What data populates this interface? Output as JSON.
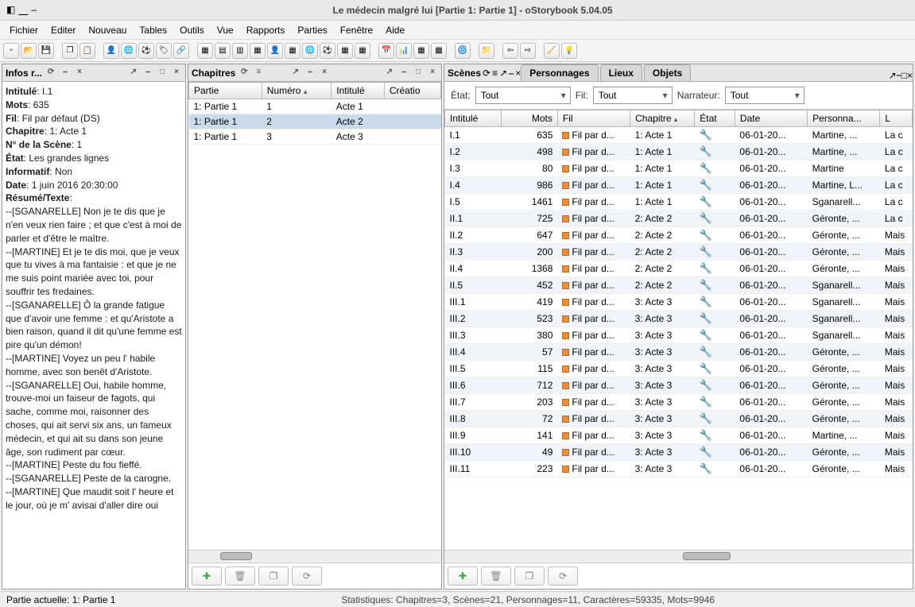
{
  "window": {
    "title": "Le médecin malgré lui [Partie 1: Partie 1] - oStorybook 5.04.05"
  },
  "menu": [
    "Fichier",
    "Editer",
    "Nouveau",
    "Tables",
    "Outils",
    "Vue",
    "Rapports",
    "Parties",
    "Fenêtre",
    "Aide"
  ],
  "panels": {
    "info": {
      "title": "Infos r..."
    },
    "chapters": {
      "title": "Chapitres"
    },
    "scenes": {
      "title": "Scènes"
    }
  },
  "tabs": {
    "personnages": "Personnages",
    "lieux": "Lieux",
    "objets": "Objets"
  },
  "info": {
    "intitule_lbl": "Intitulé",
    "intitule": "I.1",
    "mots_lbl": "Mots",
    "mots": "635",
    "fil_lbl": "Fil",
    "fil": "Fil par défaut (DS)",
    "chapitre_lbl": "Chapitre",
    "chapitre": "1: Acte 1",
    "numscene_lbl": "N° de la Scène",
    "numscene": "1",
    "etat_lbl": "État",
    "etat": "Les grandes lignes",
    "informatif_lbl": "Informatif",
    "informatif": "Non",
    "date_lbl": "Date",
    "date": "1 juin 2016 20:30:00",
    "resume_lbl": "Résumé/Texte",
    "body": "--[SGANARELLE] Non je te dis que je n'en veux rien faire ; et que c'est à moi de parler et d'être le maître.\n--[MARTINE] Et je te dis moi, que je veux que tu vives à ma fantaisie : et que je ne me suis point mariée avec toi, pour souffrir tes fredaines.\n--[SGANARELLE] Ô la grande fatigue que d'avoir une femme : et qu'Aristote a bien raison, quand il dit qu'une femme est pire qu'un démon!\n--[MARTINE] Voyez un peu l' habile homme, avec son benêt d'Aristote.\n--[SGANARELLE] Oui, habile homme, trouve-moi un faiseur de fagots, qui sache, comme moi, raisonner des choses, qui ait servi six ans, un fameux médecin, et qui ait su dans son jeune âge, son rudiment par cœur.\n--[MARTINE] Peste du fou fieffé.\n--[SGANARELLE] Peste de la carogne.\n--[MARTINE] Que maudit soit l' heure et le jour, où je m' avisai d'aller dire oui"
  },
  "chapters": {
    "headers": {
      "partie": "Partie",
      "numero": "Numéro",
      "intitule": "Intitulé",
      "creation": "Créatio"
    },
    "rows": [
      {
        "partie": "1: Partie 1",
        "num": "1",
        "intitule": "Acte 1"
      },
      {
        "partie": "1: Partie 1",
        "num": "2",
        "intitule": "Acte 2"
      },
      {
        "partie": "1: Partie 1",
        "num": "3",
        "intitule": "Acte 3"
      }
    ]
  },
  "filters": {
    "etat_lbl": "État:",
    "etat_val": "Tout",
    "fil_lbl": "Fil:",
    "fil_val": "Tout",
    "narr_lbl": "Narrateur:",
    "narr_val": "Tout"
  },
  "scenes": {
    "headers": {
      "intitule": "Intitulé",
      "mots": "Mots",
      "fil": "Fil",
      "chapitre": "Chapitre",
      "etat": "État",
      "date": "Date",
      "persos": "Personna...",
      "l": "L"
    },
    "rows": [
      {
        "i": "I.1",
        "m": "635",
        "f": "Fil par d...",
        "c": "1: Acte 1",
        "d": "06-01-20...",
        "p": "Martine, ...",
        "l": "La c"
      },
      {
        "i": "I.2",
        "m": "498",
        "f": "Fil par d...",
        "c": "1: Acte 1",
        "d": "06-01-20...",
        "p": "Martine, ...",
        "l": "La c"
      },
      {
        "i": "I.3",
        "m": "80",
        "f": "Fil par d...",
        "c": "1: Acte 1",
        "d": "06-01-20...",
        "p": "Martine",
        "l": "La c"
      },
      {
        "i": "I.4",
        "m": "986",
        "f": "Fil par d...",
        "c": "1: Acte 1",
        "d": "06-01-20...",
        "p": "Martine, L...",
        "l": "La c"
      },
      {
        "i": "I.5",
        "m": "1461",
        "f": "Fil par d...",
        "c": "1: Acte 1",
        "d": "06-01-20...",
        "p": "Sganarell...",
        "l": "La c"
      },
      {
        "i": "II.1",
        "m": "725",
        "f": "Fil par d...",
        "c": "2: Acte 2",
        "d": "06-01-20...",
        "p": "Géronte, ...",
        "l": "La c"
      },
      {
        "i": "II.2",
        "m": "647",
        "f": "Fil par d...",
        "c": "2: Acte 2",
        "d": "06-01-20...",
        "p": "Géronte, ...",
        "l": "Mais"
      },
      {
        "i": "II.3",
        "m": "200",
        "f": "Fil par d...",
        "c": "2: Acte 2",
        "d": "06-01-20...",
        "p": "Géronte, ...",
        "l": "Mais"
      },
      {
        "i": "II.4",
        "m": "1368",
        "f": "Fil par d...",
        "c": "2: Acte 2",
        "d": "06-01-20...",
        "p": "Géronte, ...",
        "l": "Mais"
      },
      {
        "i": "II.5",
        "m": "452",
        "f": "Fil par d...",
        "c": "2: Acte 2",
        "d": "06-01-20...",
        "p": "Sganarell...",
        "l": "Mais"
      },
      {
        "i": "III.1",
        "m": "419",
        "f": "Fil par d...",
        "c": "3: Acte 3",
        "d": "06-01-20...",
        "p": "Sganarell...",
        "l": "Mais"
      },
      {
        "i": "III.2",
        "m": "523",
        "f": "Fil par d...",
        "c": "3: Acte 3",
        "d": "06-01-20...",
        "p": "Sganarell...",
        "l": "Mais"
      },
      {
        "i": "III.3",
        "m": "380",
        "f": "Fil par d...",
        "c": "3: Acte 3",
        "d": "06-01-20...",
        "p": "Sganarell...",
        "l": "Mais"
      },
      {
        "i": "III.4",
        "m": "57",
        "f": "Fil par d...",
        "c": "3: Acte 3",
        "d": "06-01-20...",
        "p": "Géronte, ...",
        "l": "Mais"
      },
      {
        "i": "III.5",
        "m": "115",
        "f": "Fil par d...",
        "c": "3: Acte 3",
        "d": "06-01-20...",
        "p": "Géronte, ...",
        "l": "Mais"
      },
      {
        "i": "III.6",
        "m": "712",
        "f": "Fil par d...",
        "c": "3: Acte 3",
        "d": "06-01-20...",
        "p": "Géronte, ...",
        "l": "Mais"
      },
      {
        "i": "III.7",
        "m": "203",
        "f": "Fil par d...",
        "c": "3: Acte 3",
        "d": "06-01-20...",
        "p": "Géronte, ...",
        "l": "Mais"
      },
      {
        "i": "III.8",
        "m": "72",
        "f": "Fil par d...",
        "c": "3: Acte 3",
        "d": "06-01-20...",
        "p": "Géronte, ...",
        "l": "Mais"
      },
      {
        "i": "III.9",
        "m": "141",
        "f": "Fil par d...",
        "c": "3: Acte 3",
        "d": "06-01-20...",
        "p": "Martine, ...",
        "l": "Mais"
      },
      {
        "i": "III.10",
        "m": "49",
        "f": "Fil par d...",
        "c": "3: Acte 3",
        "d": "06-01-20...",
        "p": "Géronte, ...",
        "l": "Mais"
      },
      {
        "i": "III.11",
        "m": "223",
        "f": "Fil par d...",
        "c": "3: Acte 3",
        "d": "06-01-20...",
        "p": "Géronte, ...",
        "l": "Mais"
      }
    ]
  },
  "status": {
    "left": "Partie actuelle: 1: Partie 1",
    "center": "Statistiques: Chapitres=3,  Scènes=21,  Personnages=11,  Caractères=59335,  Mots=9946"
  }
}
